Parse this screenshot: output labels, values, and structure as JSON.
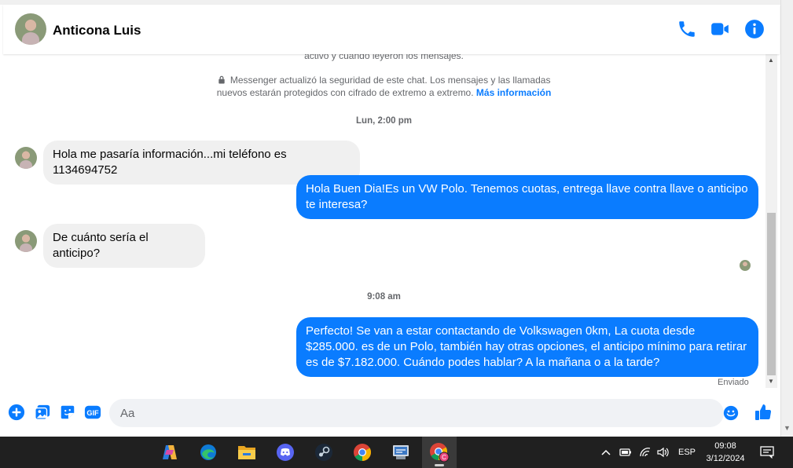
{
  "header": {
    "contact_name": "Anticona Luis"
  },
  "chat": {
    "partial_notice": "activo y cuando leyeron los mensajes.",
    "security_notice_line1": "Messenger actualizó la seguridad de este chat. Los mensajes y las llamadas",
    "security_notice_line2": "nuevos estarán protegidos con cifrado de extremo a extremo.",
    "security_link": "Más información",
    "messages": [
      {
        "type": "timestamp",
        "text": "Lun, 2:00 pm"
      },
      {
        "type": "incoming",
        "text": "Hola me pasaría información...mi teléfono es 1134694752"
      },
      {
        "type": "outgoing",
        "text": "Hola Buen Dia!Es un VW Polo. Tenemos cuotas, entrega llave contra llave o anticipo te interesa?"
      },
      {
        "type": "incoming",
        "text": "De cuánto sería el anticipo?"
      },
      {
        "type": "timestamp",
        "text": "9:08 am"
      },
      {
        "type": "outgoing",
        "text": "Perfecto!  Se van a estar contactando de Volkswagen 0km, La cuota desde $285.000. es de un Polo, también hay otras opciones, el anticipo mínimo para retirar es de $7.182.000. Cuándo podes hablar? A la mañana o a la tarde?"
      }
    ],
    "sent_status": "Enviado"
  },
  "composer": {
    "placeholder": "Aa"
  },
  "taskbar": {
    "language": "ESP",
    "time": "09:08",
    "date": "3/12/2024"
  },
  "colors": {
    "messenger_blue": "#0a7cff",
    "incoming_bubble": "#f0f0f0",
    "taskbar_bg": "#202020"
  }
}
